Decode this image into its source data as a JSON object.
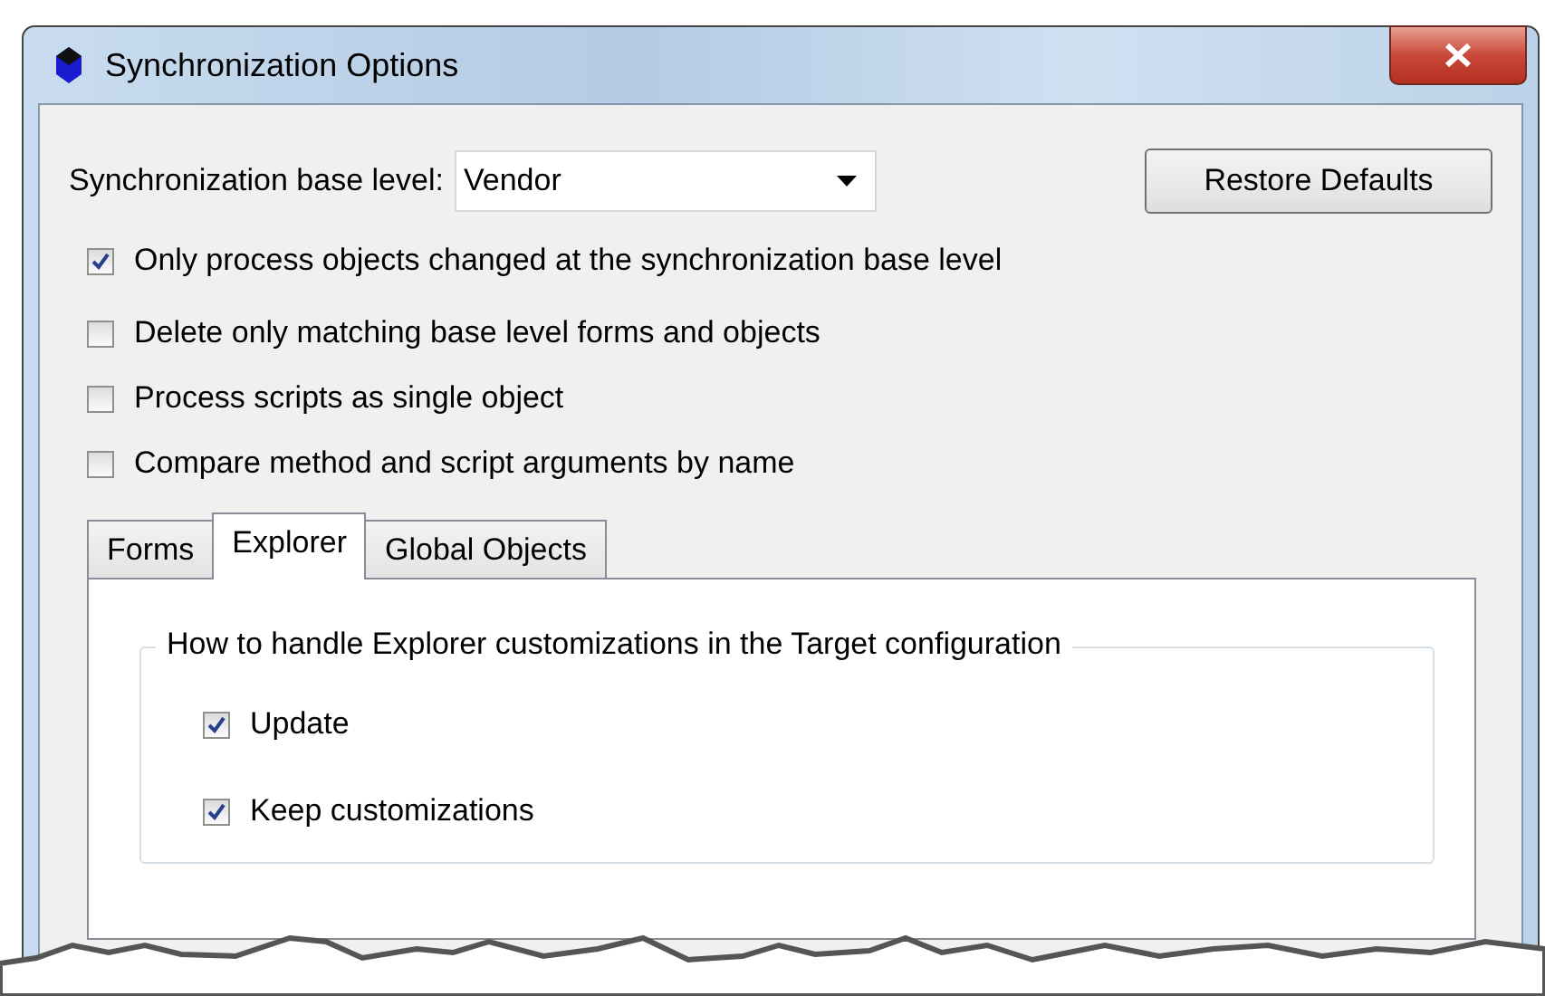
{
  "window": {
    "title": "Synchronization Options"
  },
  "base_level": {
    "label": "Synchronization base level:",
    "value": "Vendor"
  },
  "restore_button": "Restore Defaults",
  "options": [
    {
      "label": "Only process objects changed at the synchronization base level",
      "checked": true
    },
    {
      "label": "Delete only matching base level forms and objects",
      "checked": false
    },
    {
      "label": "Process scripts as single object",
      "checked": false
    },
    {
      "label": "Compare method and script arguments by name",
      "checked": false
    }
  ],
  "tabs": [
    {
      "label": "Forms",
      "selected": false
    },
    {
      "label": "Explorer",
      "selected": true
    },
    {
      "label": "Global Objects",
      "selected": false
    }
  ],
  "group": {
    "title": "How to handle Explorer customizations in the Target configuration",
    "options": [
      {
        "label": "Update",
        "checked": true
      },
      {
        "label": "Keep customizations",
        "checked": true
      }
    ]
  }
}
